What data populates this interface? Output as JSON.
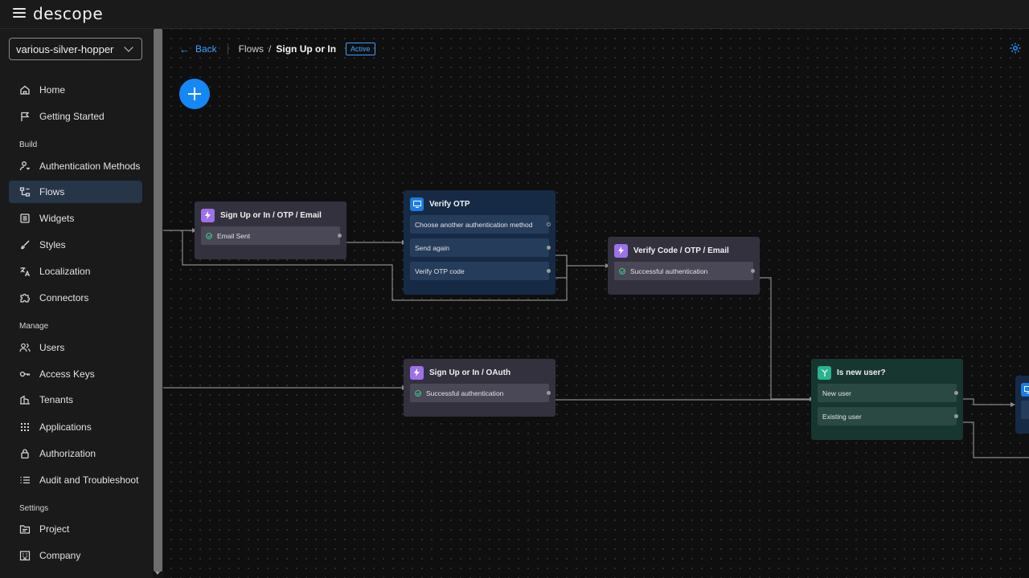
{
  "app": {
    "logo": "descope"
  },
  "project": {
    "name": "various-silver-hopper"
  },
  "nav": {
    "home": "Home",
    "getting_started": "Getting Started",
    "build_section": "Build",
    "auth_methods": "Authentication Methods",
    "flows": "Flows",
    "widgets": "Widgets",
    "styles": "Styles",
    "localization": "Localization",
    "connectors": "Connectors",
    "manage_section": "Manage",
    "users": "Users",
    "access_keys": "Access Keys",
    "tenants": "Tenants",
    "applications": "Applications",
    "authorization": "Authorization",
    "audit": "Audit and Troubleshoot",
    "settings_section": "Settings",
    "project": "Project",
    "company": "Company"
  },
  "header": {
    "back": "Back",
    "flows": "Flows",
    "separator": "/",
    "current": "Sign Up or In",
    "status": "Active"
  },
  "nodes": {
    "signup_email": {
      "title": "Sign Up or In / OTP / Email",
      "rows": [
        "Email Sent"
      ]
    },
    "verify_otp": {
      "title": "Verify OTP",
      "rows": [
        "Choose another authentication method",
        "Send again",
        "Verify OTP code"
      ]
    },
    "verify_code": {
      "title": "Verify Code / OTP / Email",
      "rows": [
        "Successful authentication"
      ]
    },
    "signup_oauth": {
      "title": "Sign Up or In / OAuth",
      "rows": [
        "Successful authentication"
      ]
    },
    "is_new_user": {
      "title": "Is new user?",
      "rows": [
        "New user",
        "Existing user"
      ]
    }
  },
  "colors": {
    "accent": "#1488f5",
    "action_node": "#34313f",
    "screen_node": "#162a45",
    "condition_node": "#183630",
    "success": "#3fc48a"
  }
}
